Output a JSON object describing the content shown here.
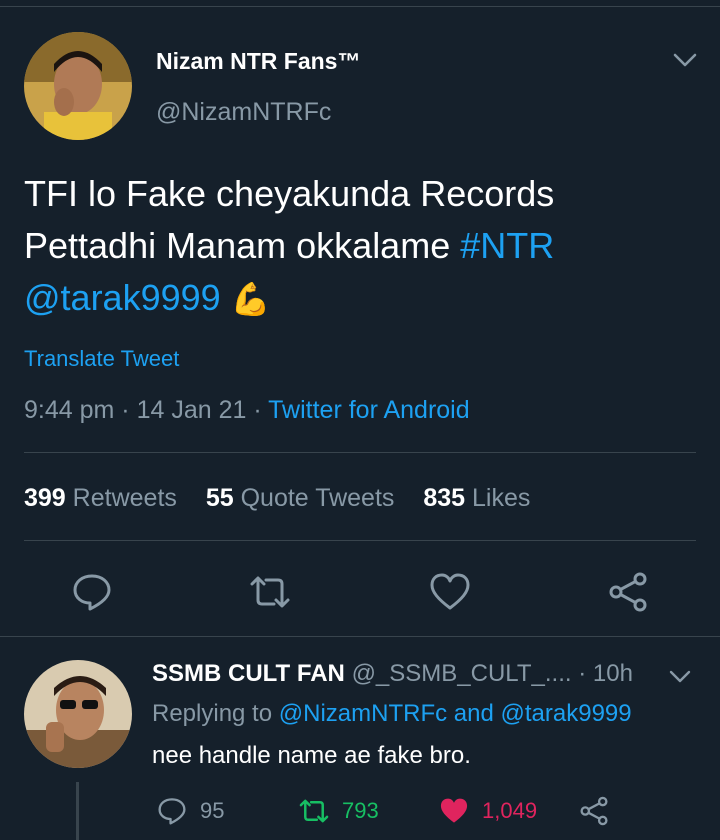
{
  "tweet": {
    "display_name": "Nizam NTR Fans™",
    "handle": "@NizamNTRFc",
    "text_line1": "TFI lo Fake cheyakunda Records",
    "text_line2_plain": "Pettadhi Manam okkalame ",
    "hashtag": "#NTR",
    "mention": "@tarak9999",
    "emoji": "💪",
    "translate_label": "Translate Tweet",
    "time": "9:44 pm",
    "date": "14 Jan 21",
    "source": "Twitter for Android",
    "stats": {
      "retweets_count": "399",
      "retweets_label": "Retweets",
      "quotes_count": "55",
      "quotes_label": "Quote Tweets",
      "likes_count": "835",
      "likes_label": "Likes"
    }
  },
  "reply": {
    "display_name": "SSMB CULT FAN",
    "handle": "@_SSMB_CULT_....",
    "time": "10h",
    "replying_prefix": "Replying to",
    "replying_user1": "@NizamNTRFc",
    "replying_and": "and",
    "replying_user2": "@tarak9999",
    "text": "nee handle name ae fake bro.",
    "reply_count": "95",
    "retweet_count": "793",
    "like_count": "1,049"
  },
  "colors": {
    "background": "#15202b",
    "link": "#1da1f2",
    "secondary_text": "#8899a6",
    "retweet_green": "#17bf63",
    "like_red": "#e0245e",
    "separator": "#38444d"
  },
  "icons": {
    "reply": "speech-bubble-icon",
    "retweet": "retweet-arrows-icon",
    "like": "heart-icon",
    "share": "share-nodes-icon",
    "menu": "chevron-down-icon"
  }
}
